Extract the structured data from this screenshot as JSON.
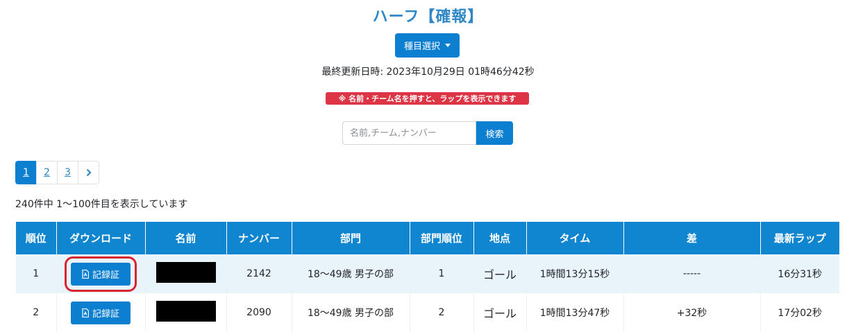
{
  "title": "ハーフ【確報】",
  "event_select_label": "種目選択",
  "updated_text": "最終更新日時: 2023年10月29日 01時46分42秒",
  "notice_text": "※ 名前・チーム名を押すと、ラップを表示できます",
  "search": {
    "placeholder": "名前,チーム,ナンバー",
    "button_label": "検索"
  },
  "pagination": {
    "pages": [
      "1",
      "2",
      "3"
    ],
    "next": "›"
  },
  "count_text": "240件中 1〜100件目を表示しています",
  "table": {
    "headers": [
      "順位",
      "ダウンロード",
      "名前",
      "ナンバー",
      "部門",
      "部門順位",
      "地点",
      "タイム",
      "差",
      "最新ラップ"
    ],
    "cert_label": "記録証",
    "rows": [
      {
        "rank": "1",
        "number": "2142",
        "division": "18〜49歳 男子の部",
        "div_rank": "1",
        "point": "ゴール",
        "time": "1時間13分15秒",
        "diff": "-----",
        "lap": "16分31秒"
      },
      {
        "rank": "2",
        "number": "2090",
        "division": "18〜49歳 男子の部",
        "div_rank": "2",
        "point": "ゴール",
        "time": "1時間13分47秒",
        "diff": "+32秒",
        "lap": "17分02秒"
      }
    ]
  },
  "colors": {
    "primary": "#0d7fd1",
    "title": "#2f88c6",
    "danger": "#dc3545",
    "highlight": "#d9232e"
  },
  "icons": {
    "cert": "pdf-file-icon",
    "next": "chevron-right-icon"
  }
}
